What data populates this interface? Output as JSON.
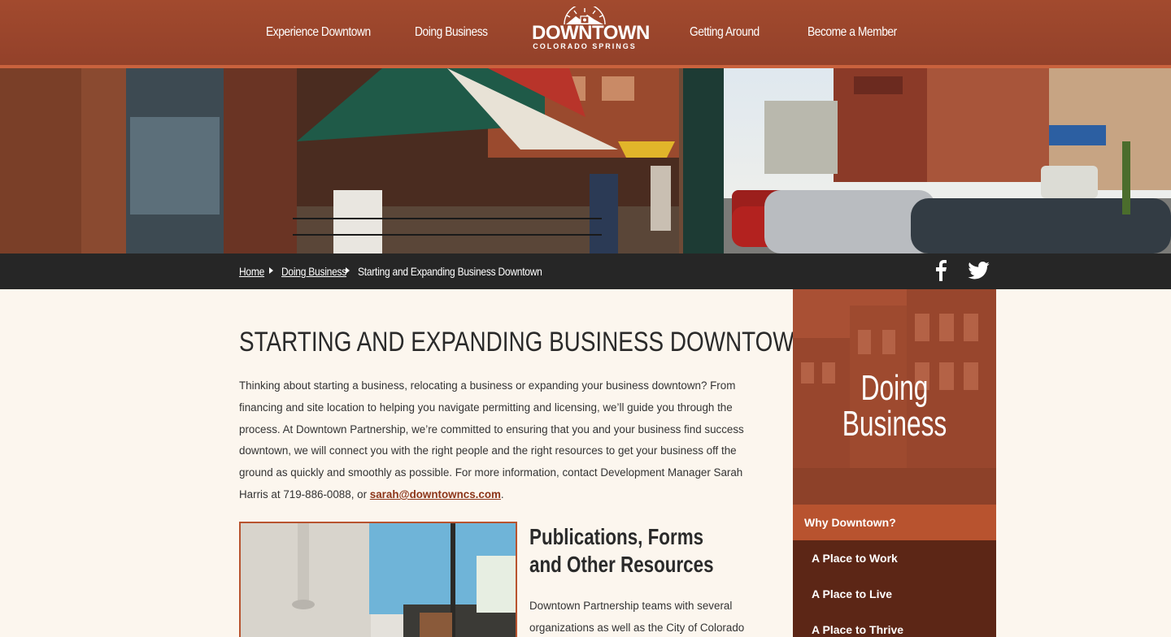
{
  "nav": {
    "experience": "Experience Downtown",
    "doing_business": "Doing Business",
    "getting_around": "Getting Around",
    "become_member": "Become a Member"
  },
  "logo": {
    "main": "DOWNTOWN",
    "sub": "COLORADO SPRINGS"
  },
  "breadcrumb": {
    "home": "Home",
    "doing_business": "Doing Business",
    "current": "Starting and Expanding Business Downtown"
  },
  "social": [
    "facebook-icon",
    "twitter-icon"
  ],
  "main": {
    "title": "STARTING AND EXPANDING BUSINESS DOWNTOWN",
    "intro": "Thinking about starting a business, relocating a business or expanding your business downtown? From financing and site location to helping you navigate permitting and licensing, we’ll guide you through the process. At Downtown Partnership, we’re committed to ensuring that you and your business find success downtown, we will connect you with the right people and the right resources to get your business off the ground as quickly and smoothly as possible. For more information, contact Development Manager Sarah Harris at 719-886-0088, or ",
    "email": "sarah@downtowncs.com",
    "intro_end": ".",
    "section_title": "Publications, Forms and Other Resources",
    "section_text": "Downtown Partnership teams with several organizations as well as the City of Colorado"
  },
  "sidebar": {
    "title_line1": "Doing",
    "title_line2": "Business",
    "items": [
      {
        "label": "Why Downtown?"
      },
      {
        "label": "A Place to Work"
      },
      {
        "label": "A Place to Live"
      },
      {
        "label": "A Place to Thrive"
      }
    ]
  },
  "colors": {
    "brand": "#9e462c",
    "accent": "#b8532f",
    "sidebar_dark": "#5c2616",
    "breadcrumb_bg": "#262626",
    "page_bg": "#fcf6ee"
  }
}
